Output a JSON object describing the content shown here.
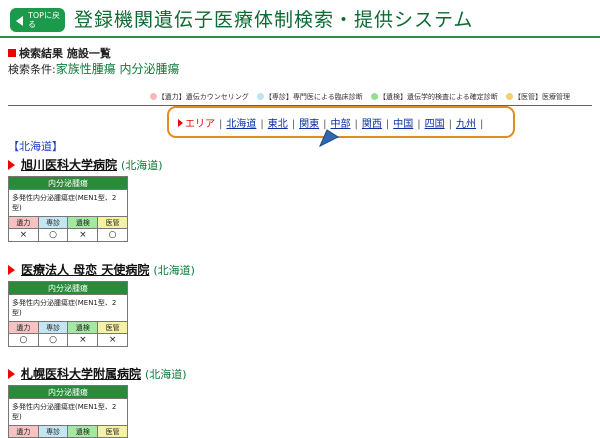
{
  "header": {
    "top_button_label": "TOPに戻る",
    "title": "登録機関遺伝子医療体制検索・提供システム"
  },
  "search": {
    "heading": "検索結果 施設一覧",
    "condition_label": "検索条件:",
    "condition_value": "家族性腫瘍 内分泌腫瘍"
  },
  "legend": [
    {
      "text": "【遺力】遺伝カウンセリング",
      "color": "#f4b8b8"
    },
    {
      "text": "【専診】専門医による臨床診断",
      "color": "#bfe3f2"
    },
    {
      "text": "【遺検】遺伝学的検査による確定診断",
      "color": "#8fe08f"
    },
    {
      "text": "【医管】医療管理",
      "color": "#f0d070"
    }
  ],
  "area_nav": {
    "label": "エリア",
    "items": [
      "北海道",
      "東北",
      "関東",
      "中部",
      "関西",
      "中国",
      "四国",
      "九州"
    ]
  },
  "region": "【北海道】",
  "card_labels": {
    "header": "内分泌腫瘍",
    "detail": "多発性内分泌腫瘍症(MEN1型、2型)",
    "cols": [
      "遺力",
      "専診",
      "遺検",
      "医管"
    ]
  },
  "hospitals": [
    {
      "name": "旭川医科大学病院",
      "pref": "(北海道)",
      "marks": [
        "×",
        "○",
        "×",
        "○"
      ]
    },
    {
      "name": "医療法人 母恋 天使病院",
      "pref": "(北海道)",
      "marks": [
        "○",
        "○",
        "×",
        "×"
      ]
    },
    {
      "name": "札幌医科大学附属病院",
      "pref": "(北海道)",
      "marks": []
    }
  ]
}
